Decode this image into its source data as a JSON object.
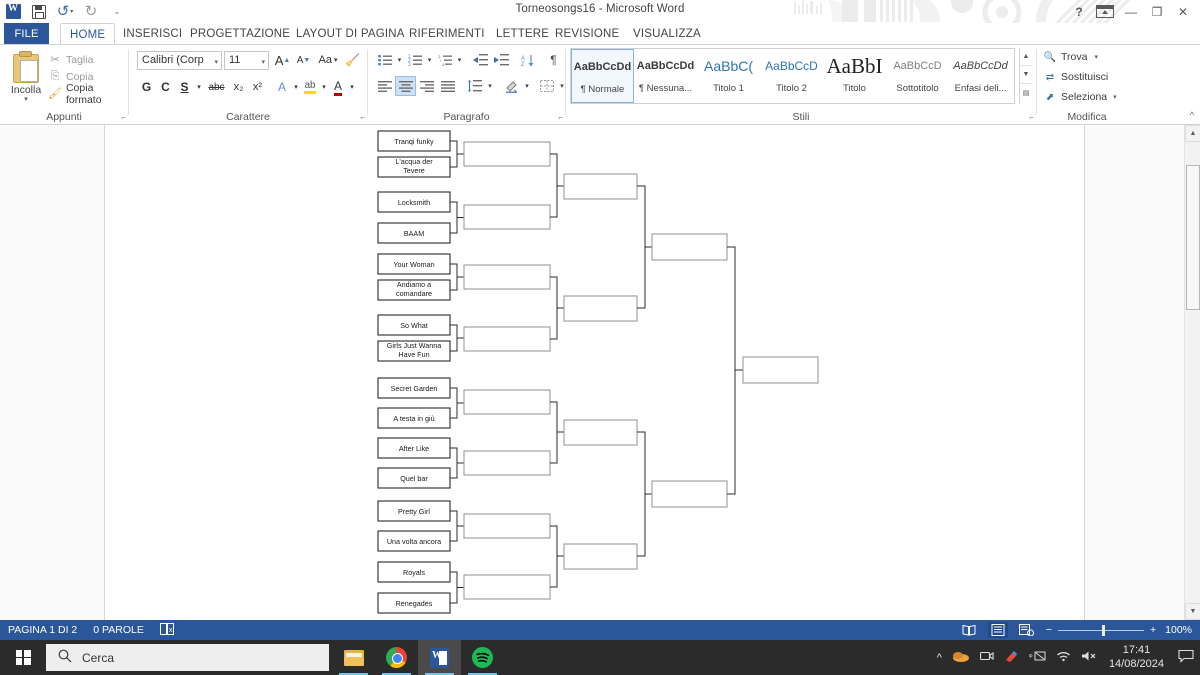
{
  "window": {
    "title": "Torneosongs16 - Microsoft Word",
    "quick_access": {
      "word_logo": "word-logo",
      "save": "save-icon",
      "undo": "↺",
      "redo": "↻",
      "customize": "▾"
    },
    "controls": {
      "help": "?",
      "ribbon_options": "ribbon-display-options",
      "minimize": "—",
      "restore": "❐",
      "close": "✕"
    }
  },
  "tabs": [
    {
      "label": "FILE",
      "id": "file"
    },
    {
      "label": "HOME",
      "id": "home"
    },
    {
      "label": "INSERISCI",
      "id": "inserisci"
    },
    {
      "label": "PROGETTAZIONE",
      "id": "progettazione"
    },
    {
      "label": "LAYOUT DI PAGINA",
      "id": "layout"
    },
    {
      "label": "RIFERIMENTI",
      "id": "riferimenti"
    },
    {
      "label": "LETTERE",
      "id": "lettere"
    },
    {
      "label": "REVISIONE",
      "id": "revisione"
    },
    {
      "label": "VISUALIZZA",
      "id": "visualizza"
    }
  ],
  "active_tab": "HOME",
  "ribbon": {
    "clipboard": {
      "group_label": "Appunti",
      "paste_label": "Incolla",
      "cut_label": "Taglia",
      "copy_label": "Copia",
      "format_painter_label": "Copia formato"
    },
    "font": {
      "group_label": "Carattere",
      "font_name": "Calibri (Corp",
      "font_size": "11",
      "grow_font": "A",
      "shrink_font": "A",
      "change_case": "Aa",
      "clear_formatting": "clear-format-icon",
      "bold": "G",
      "italic": "C",
      "underline": "S",
      "strikethrough": "abc",
      "subscript": "x₂",
      "superscript": "x²",
      "text_effects": "A",
      "highlight": "ab",
      "font_color": "A"
    },
    "paragraph": {
      "group_label": "Paragrafo",
      "bullets": "bullet-list-icon",
      "numbering": "numbered-list-icon",
      "multilevel": "multilevel-list-icon",
      "decrease_indent": "decrease-indent-icon",
      "increase_indent": "increase-indent-icon",
      "sort": "sort-icon",
      "show_marks": "¶",
      "align_left": "align-left-icon",
      "align_center": "align-center-icon",
      "align_right": "align-right-icon",
      "justify": "justify-icon",
      "line_spacing": "line-spacing-icon",
      "shading": "shading-icon",
      "borders": "borders-icon"
    },
    "styles": {
      "group_label": "Stili",
      "items": [
        {
          "preview": "AaBbCcDd",
          "name": "¶ Normale",
          "variant": "normal",
          "selected": true
        },
        {
          "preview": "AaBbCcDd",
          "name": "¶ Nessuna...",
          "variant": "normal",
          "selected": false
        },
        {
          "preview": "AaBbC(",
          "name": "Titolo 1",
          "variant": "blue",
          "selected": false
        },
        {
          "preview": "AaBbCcD",
          "name": "Titolo 2",
          "variant": "blue",
          "selected": false
        },
        {
          "preview": "AaBbI",
          "name": "Titolo",
          "variant": "big",
          "selected": false
        },
        {
          "preview": "AaBbCcD",
          "name": "Sottotitolo",
          "variant": "gray",
          "selected": false
        },
        {
          "preview": "AaBbCcDd",
          "name": "Enfasi deli...",
          "variant": "ital",
          "selected": false
        }
      ]
    },
    "editing": {
      "group_label": "Modifica",
      "find_label": "Trova",
      "replace_label": "Sostituisci",
      "select_label": "Seleziona"
    },
    "collapse_ribbon": "^"
  },
  "status_bar": {
    "page": "PAGINA 1 DI 2",
    "words": "0 PAROLE",
    "proofing": "proofing-icon",
    "views": [
      "read-mode-icon",
      "print-layout-icon",
      "web-layout-icon"
    ],
    "active_view": "print-layout-icon",
    "zoom_out": "−",
    "zoom_in": "+",
    "zoom_level": "100%"
  },
  "taskbar": {
    "start": "windows-start-icon",
    "search_placeholder": "Cerca",
    "apps": [
      {
        "name": "file-explorer",
        "open": true
      },
      {
        "name": "google-chrome",
        "open": true
      },
      {
        "name": "microsoft-word",
        "open": true,
        "active": true
      },
      {
        "name": "spotify",
        "open": true
      }
    ],
    "tray": [
      "show-hidden-icons",
      "onedrive-icon",
      "camera-icon",
      "paint-icon",
      "keyboard-icon",
      "wifi-icon",
      "volume-muted-icon"
    ],
    "time": "17:41",
    "date": "14/08/2024",
    "notifications": "notification-icon"
  },
  "document": {
    "bracket": {
      "title": "Torneo songs 16",
      "rounds": 4,
      "round1": [
        "Tranqi funky",
        "L'acqua der Tevere",
        "Locksmith",
        "BAAM",
        "Your Woman",
        "Andiamo a comandare",
        "So What",
        "Girls Just Wanna Have Fun",
        "Secret Garden",
        "A testa in giù",
        "After Like",
        "Quel bar",
        "Pretty Girl",
        "Una volta ancora",
        "Royals",
        "Renegades"
      ],
      "round2": [
        "",
        "",
        "",
        "",
        "",
        "",
        "",
        ""
      ],
      "round3": [
        "",
        "",
        "",
        ""
      ],
      "round4": [
        "",
        ""
      ],
      "final": [
        ""
      ]
    }
  }
}
